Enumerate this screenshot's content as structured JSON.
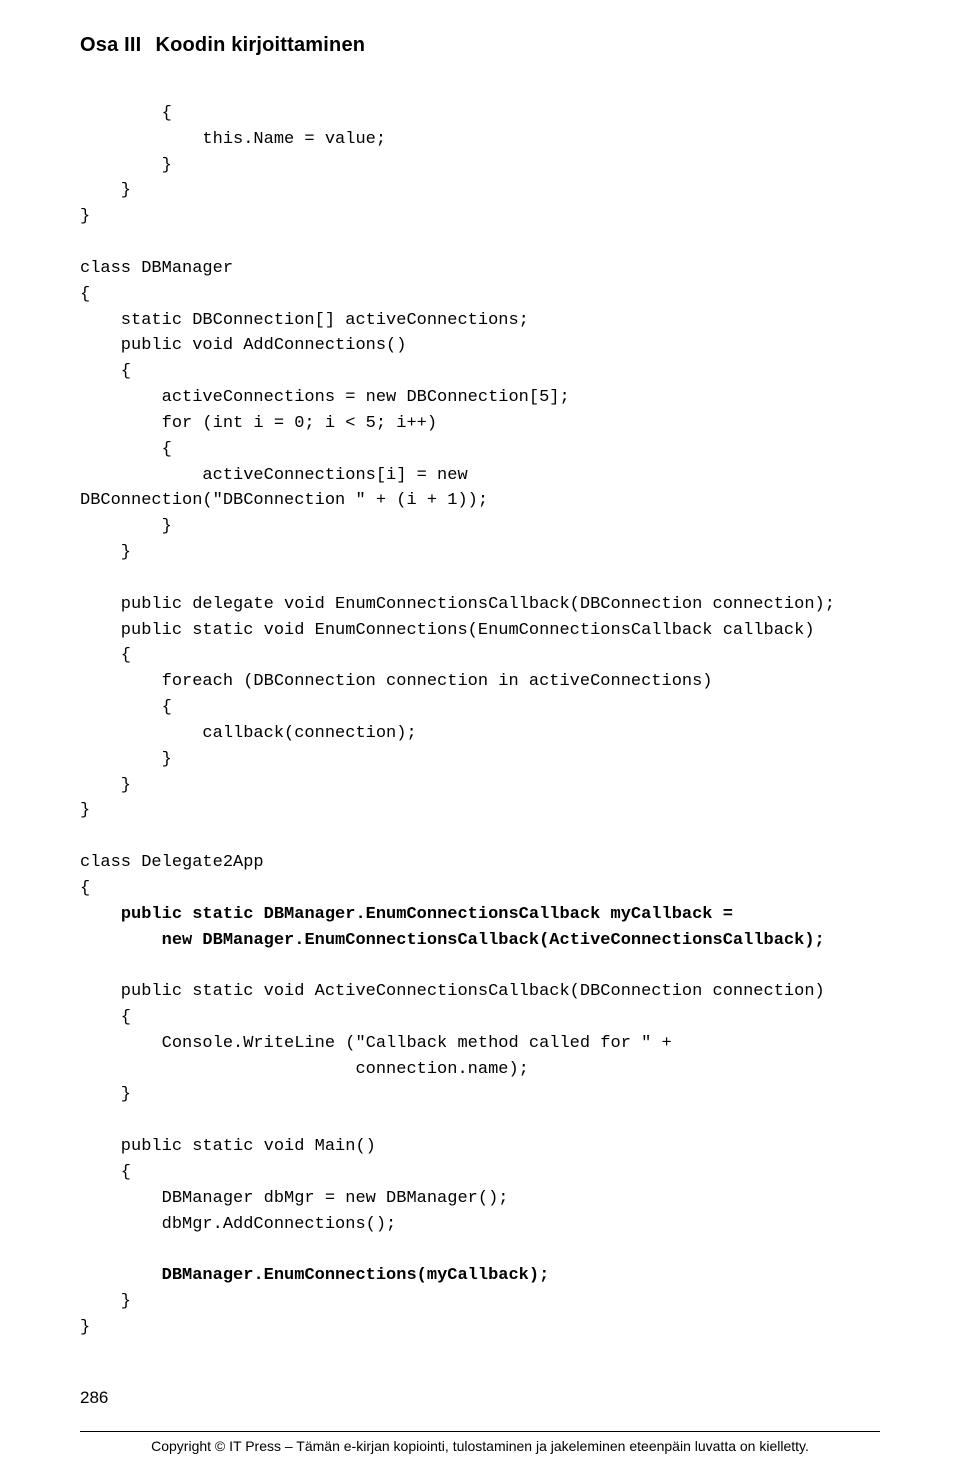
{
  "header": {
    "part": "Osa III",
    "title": "Koodin kirjoittaminen"
  },
  "code": {
    "l1": "        {",
    "l2": "            this.Name = value;",
    "l3": "        }",
    "l4": "    }",
    "l5": "}",
    "l6": "",
    "l7": "class DBManager",
    "l8": "{",
    "l9": "    static DBConnection[] activeConnections;",
    "l10": "    public void AddConnections()",
    "l11": "    {",
    "l12": "        activeConnections = new DBConnection[5];",
    "l13": "        for (int i = 0; i < 5; i++)",
    "l14": "        {",
    "l15": "            activeConnections[i] = new",
    "l16": "DBConnection(\"DBConnection \" + (i + 1));",
    "l17": "        }",
    "l18": "    }",
    "l19": "",
    "l20": "    public delegate void EnumConnectionsCallback(DBConnection connection);",
    "l21": "    public static void EnumConnections(EnumConnectionsCallback callback)",
    "l22": "    {",
    "l23": "        foreach (DBConnection connection in activeConnections)",
    "l24": "        {",
    "l25": "            callback(connection);",
    "l26": "        }",
    "l27": "    }",
    "l28": "}",
    "l29": "",
    "l30": "class Delegate2App",
    "l31": "{",
    "l32a": "    ",
    "l32b": "public static DBManager.EnumConnectionsCallback myCallback =",
    "l33a": "        ",
    "l33b": "new DBManager.EnumConnectionsCallback(ActiveConnectionsCallback);",
    "l34": "",
    "l35": "    public static void ActiveConnectionsCallback(DBConnection connection)",
    "l36": "    {",
    "l37": "        Console.WriteLine (\"Callback method called for \" +",
    "l38": "                           connection.name);",
    "l39": "    }",
    "l40": "",
    "l41": "    public static void Main()",
    "l42": "    {",
    "l43": "        DBManager dbMgr = new DBManager();",
    "l44": "        dbMgr.AddConnections();",
    "l45": "",
    "l46a": "        ",
    "l46b": "DBManager.EnumConnections(myCallback);",
    "l47": "    }",
    "l48": "}"
  },
  "page_number": "286",
  "footer": "Copyright © IT Press – Tämän e-kirjan kopiointi, tulostaminen ja jakeleminen eteenpäin luvatta on kielletty."
}
